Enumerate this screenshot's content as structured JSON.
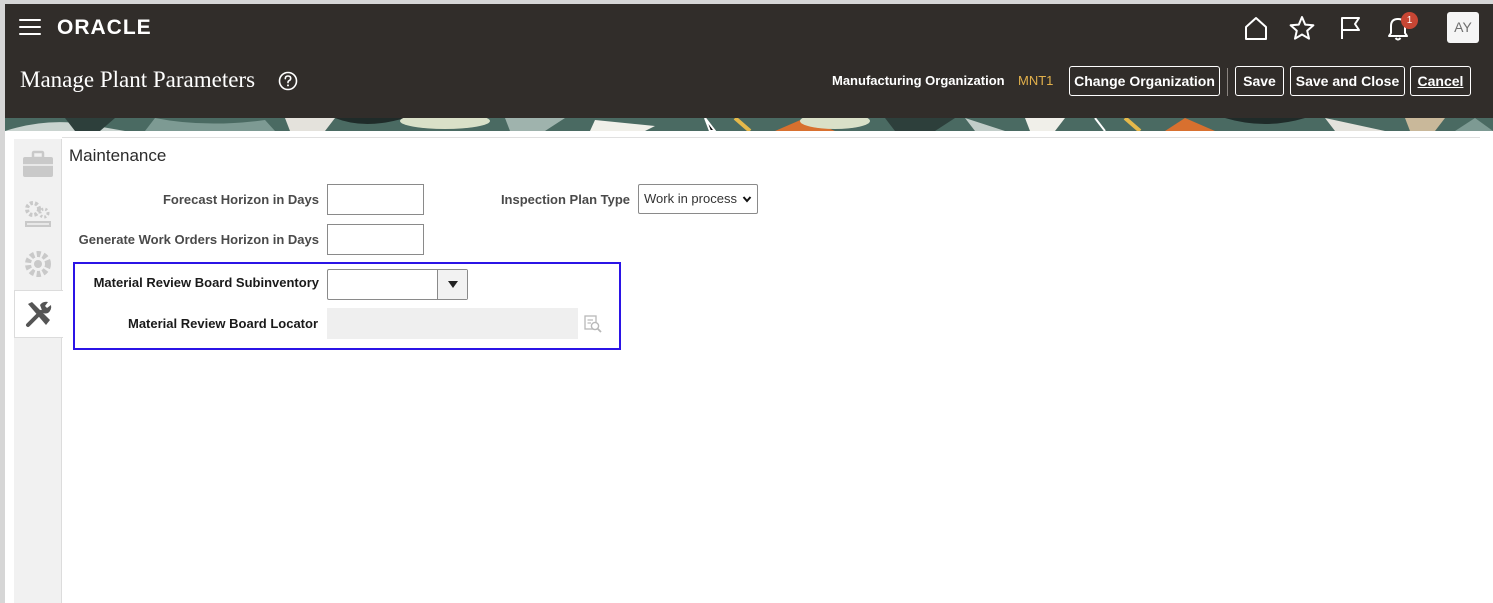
{
  "header": {
    "logo": "ORACLE",
    "page_title": "Manage Plant Parameters",
    "notification_count": "1",
    "avatar_initials": "AY",
    "org_label": "Manufacturing Organization",
    "org_value": "MNT1",
    "buttons": {
      "change_org": "Change Organization",
      "save": "Save",
      "save_close": "Save and Close",
      "cancel": "Cancel"
    }
  },
  "section": {
    "title": "Maintenance"
  },
  "fields": {
    "forecast_horizon": {
      "label": "Forecast Horizon in Days",
      "value": ""
    },
    "generate_wo_horizon": {
      "label": "Generate Work Orders Horizon in Days",
      "value": ""
    },
    "inspection_plan_type": {
      "label": "Inspection Plan Type",
      "value": "Work in process"
    },
    "mrb_subinventory": {
      "label": "Material Review Board Subinventory",
      "value": ""
    },
    "mrb_locator": {
      "label": "Material Review Board Locator",
      "value": ""
    }
  },
  "colors": {
    "header_bg": "#312d2a",
    "org_value": "#e2b04b",
    "badge": "#c74634",
    "highlight": "#2b14e6"
  },
  "icons": [
    "hamburger-icon",
    "home-icon",
    "star-icon",
    "flag-icon",
    "bell-icon",
    "help-icon",
    "briefcase-icon",
    "gears-icon",
    "gear-icon",
    "tools-icon",
    "chevron-down-icon",
    "search-icon"
  ]
}
